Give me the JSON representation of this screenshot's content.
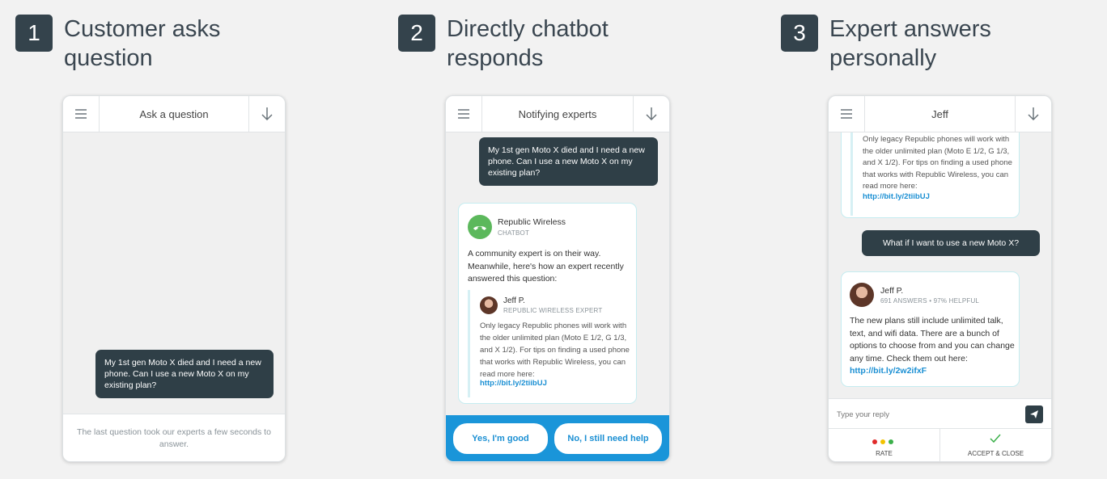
{
  "steps": [
    {
      "number": "1",
      "title": "Customer asks question"
    },
    {
      "number": "2",
      "title": "Directly chatbot responds"
    },
    {
      "number": "3",
      "title": "Expert answers personally"
    }
  ],
  "phone1": {
    "header_title": "Ask a question",
    "message": "My 1st gen Moto X died and I need a new phone. Can I use a new Moto X on my existing plan?",
    "footer_text": "The last question took our experts a few seconds to answer."
  },
  "phone2": {
    "header_title": "Notifying experts",
    "message": "My 1st gen Moto X died and I need a new phone. Can I use a new Moto X on my existing plan?",
    "bot_name": "Republic Wireless",
    "bot_role": "CHATBOT",
    "bot_text": "A community expert is on their way. Meanwhile, here's how an expert recently answered this question:",
    "expert_name": "Jeff P.",
    "expert_role": "REPUBLIC WIRELESS EXPERT",
    "expert_answer": "Only legacy Republic phones will work with the older unlimited plan (Moto E 1/2, G 1/3, and X 1/2). For tips on finding a used phone that works with Republic Wireless, you can read more here:",
    "expert_link": "http://bit.ly/2tiibUJ",
    "button_good": "Yes, I'm good",
    "button_help": "No, I still need help",
    "accent_color": "#1a95d9"
  },
  "phone3": {
    "header_title": "Jeff",
    "prev_answer": "Only legacy Republic phones will work with the older unlimited plan (Moto E 1/2, G 1/3, and X 1/2). For tips on finding a used phone that works with Republic Wireless, you can read more here:",
    "prev_link": "http://bit.ly/2tiibUJ",
    "user_message": "What if I want to use a new Moto X?",
    "expert_name": "Jeff P.",
    "expert_stats": "691 ANSWERS • 97% HELPFUL",
    "expert_answer": "The new plans still include unlimited talk, text, and wifi data. There are a bunch of options to choose from and you can change any time. Check them out here:",
    "expert_link": "http://bit.ly/2w2ifxF",
    "reply_placeholder": "Type your reply",
    "rate_label": "RATE",
    "accept_label": "ACCEPT & CLOSE",
    "rate_colors": [
      "#e02b2b",
      "#f2c200",
      "#3bb04a"
    ]
  }
}
